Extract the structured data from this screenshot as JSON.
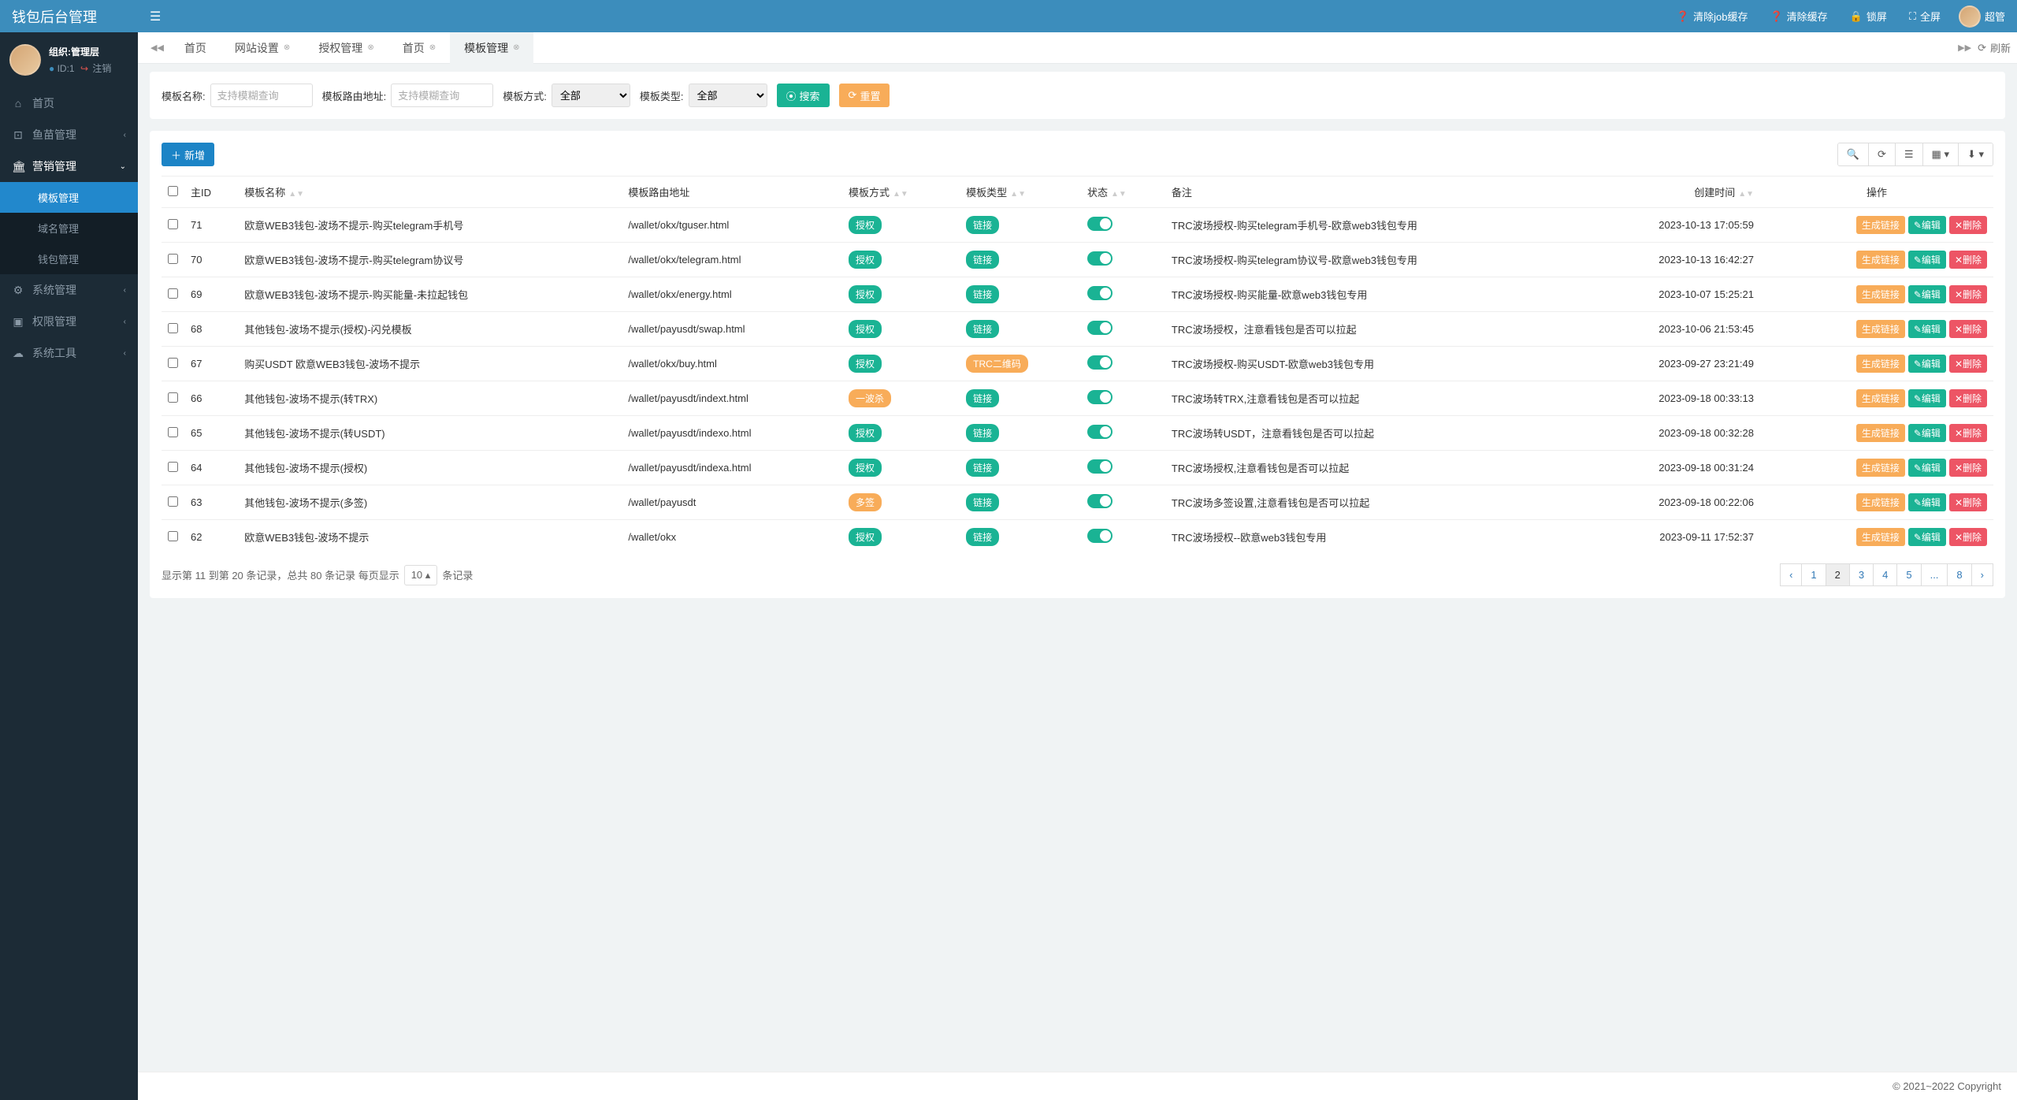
{
  "brand": "钱包后台管理",
  "user": {
    "org": "组织:管理层",
    "id_label": "ID:1",
    "logout": "注销"
  },
  "topbar": {
    "clear_job": "清除job缓存",
    "clear_cache": "清除缓存",
    "lock": "锁屏",
    "fullscreen": "全屏",
    "username": "超管"
  },
  "sidebar": {
    "home": "首页",
    "fish": "鱼苗管理",
    "marketing": "营销管理",
    "marketing_items": {
      "template": "模板管理",
      "domain": "域名管理",
      "wallet": "钱包管理"
    },
    "system": "系统管理",
    "permission": "权限管理",
    "tools": "系统工具"
  },
  "tabs": {
    "home1": "首页",
    "site": "网站设置",
    "auth": "授权管理",
    "home2": "首页",
    "template": "模板管理",
    "refresh": "刷新"
  },
  "search": {
    "name_label": "模板名称:",
    "name_placeholder": "支持模糊查询",
    "route_label": "模板路由地址:",
    "route_placeholder": "支持模糊查询",
    "method_label": "模板方式:",
    "type_label": "模板类型:",
    "all": "全部",
    "search_btn": "搜索",
    "reset_btn": "重置"
  },
  "toolbar": {
    "add": "新增"
  },
  "table": {
    "headers": {
      "id": "主ID",
      "name": "模板名称",
      "route": "模板路由地址",
      "method": "模板方式",
      "type": "模板类型",
      "status": "状态",
      "note": "备注",
      "time": "创建时间",
      "action": "操作"
    },
    "actions": {
      "gen": "生成链接",
      "edit": "编辑",
      "del": "删除"
    },
    "rows": [
      {
        "id": "71",
        "name": "欧意WEB3钱包-波场不提示-购买telegram手机号",
        "route": "/wallet/okx/tguser.html",
        "method": "授权",
        "method_cls": "badge-auth",
        "type": "链接",
        "type_cls": "badge-link",
        "note": "TRC波场授权-购买telegram手机号-欧意web3钱包专用",
        "time": "2023-10-13 17:05:59"
      },
      {
        "id": "70",
        "name": "欧意WEB3钱包-波场不提示-购买telegram协议号",
        "route": "/wallet/okx/telegram.html",
        "method": "授权",
        "method_cls": "badge-auth",
        "type": "链接",
        "type_cls": "badge-link",
        "note": "TRC波场授权-购买telegram协议号-欧意web3钱包专用",
        "time": "2023-10-13 16:42:27"
      },
      {
        "id": "69",
        "name": "欧意WEB3钱包-波场不提示-购买能量-未拉起钱包",
        "route": "/wallet/okx/energy.html",
        "method": "授权",
        "method_cls": "badge-auth",
        "type": "链接",
        "type_cls": "badge-link",
        "note": "TRC波场授权-购买能量-欧意web3钱包专用",
        "time": "2023-10-07 15:25:21"
      },
      {
        "id": "68",
        "name": "其他钱包-波场不提示(授权)-闪兑模板",
        "route": "/wallet/payusdt/swap.html",
        "method": "授权",
        "method_cls": "badge-auth",
        "type": "链接",
        "type_cls": "badge-link",
        "note": "TRC波场授权，注意看钱包是否可以拉起",
        "time": "2023-10-06 21:53:45"
      },
      {
        "id": "67",
        "name": "购买USDT 欧意WEB3钱包-波场不提示",
        "route": "/wallet/okx/buy.html",
        "method": "授权",
        "method_cls": "badge-auth",
        "type": "TRC二维码",
        "type_cls": "badge-qr",
        "note": "TRC波场授权-购买USDT-欧意web3钱包专用",
        "time": "2023-09-27 23:21:49"
      },
      {
        "id": "66",
        "name": "其他钱包-波场不提示(转TRX)",
        "route": "/wallet/payusdt/indext.html",
        "method": "一波杀",
        "method_cls": "badge-kill",
        "type": "链接",
        "type_cls": "badge-link",
        "note": "TRC波场转TRX,注意看钱包是否可以拉起",
        "time": "2023-09-18 00:33:13"
      },
      {
        "id": "65",
        "name": "其他钱包-波场不提示(转USDT)",
        "route": "/wallet/payusdt/indexo.html",
        "method": "授权",
        "method_cls": "badge-auth",
        "type": "链接",
        "type_cls": "badge-link",
        "note": "TRC波场转USDT，注意看钱包是否可以拉起",
        "time": "2023-09-18 00:32:28"
      },
      {
        "id": "64",
        "name": "其他钱包-波场不提示(授权)",
        "route": "/wallet/payusdt/indexa.html",
        "method": "授权",
        "method_cls": "badge-auth",
        "type": "链接",
        "type_cls": "badge-link",
        "note": "TRC波场授权,注意看钱包是否可以拉起",
        "time": "2023-09-18 00:31:24"
      },
      {
        "id": "63",
        "name": "其他钱包-波场不提示(多签)",
        "route": "/wallet/payusdt",
        "method": "多签",
        "method_cls": "badge-multi",
        "type": "链接",
        "type_cls": "badge-link",
        "note": "TRC波场多签设置,注意看钱包是否可以拉起",
        "time": "2023-09-18 00:22:06"
      },
      {
        "id": "62",
        "name": "欧意WEB3钱包-波场不提示",
        "route": "/wallet/okx",
        "method": "授权",
        "method_cls": "badge-auth",
        "type": "链接",
        "type_cls": "badge-link",
        "note": "TRC波场授权--欧意web3钱包专用",
        "time": "2023-09-11 17:52:37"
      }
    ]
  },
  "pagination": {
    "info_pre": "显示第 11 到第 20 条记录，总共 80 条记录   每页显示",
    "page_size": "10",
    "info_post": "条记录",
    "pages": [
      "‹",
      "1",
      "2",
      "3",
      "4",
      "5",
      "...",
      "8",
      "›"
    ],
    "active_idx": 2
  },
  "footer": "© 2021~2022 Copyright"
}
